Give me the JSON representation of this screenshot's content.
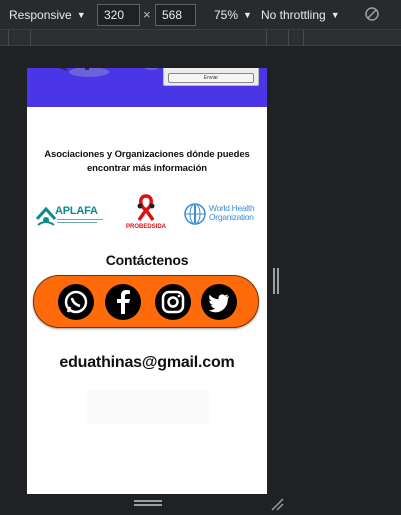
{
  "devtools": {
    "device_mode": "Responsive",
    "width": "320",
    "times": "×",
    "height": "568",
    "zoom": "75%",
    "throttling": "No throttling"
  },
  "page": {
    "form": {
      "send_button": "Enviar"
    },
    "orgs_heading": "Asociaciones y Organizaciones dónde puedes encontrar más información",
    "logos": {
      "aplafa": "APLAFA",
      "probedsida": "PROBEDSIDA",
      "who": "World Health Organization"
    },
    "contact_title": "Contáctenos",
    "social_icons": [
      "whatsapp-icon",
      "facebook-icon",
      "instagram-icon",
      "twitter-icon"
    ],
    "email": "eduathinas@gmail.com"
  },
  "colors": {
    "hero": "#4a36e6",
    "social_bar": "#ff6a0a",
    "aplafa": "#0b8a8c",
    "who": "#3b8ed6",
    "probedsida": "#dd1111"
  }
}
